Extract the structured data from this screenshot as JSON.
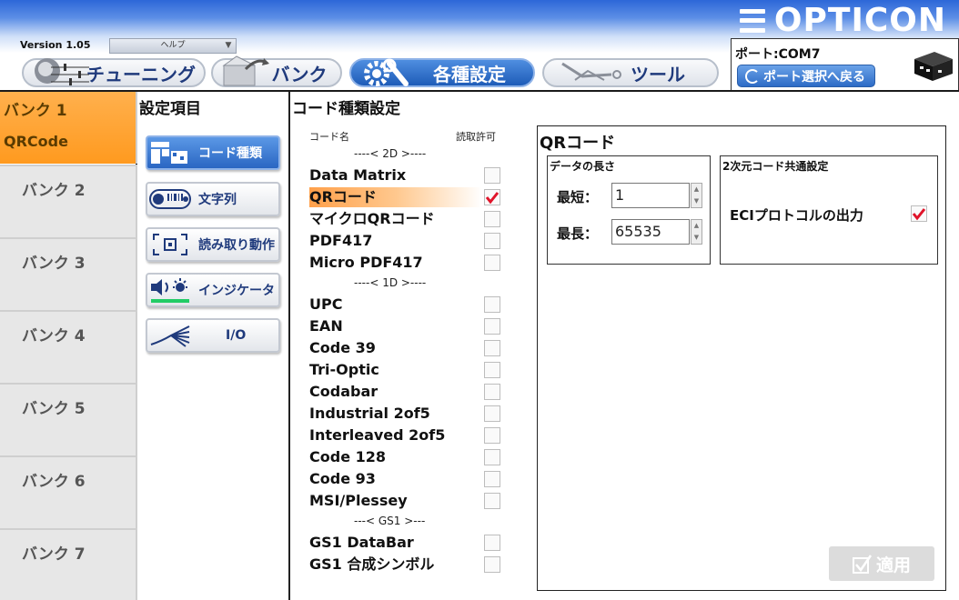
{
  "header": {
    "brand": "OPTICON",
    "version": "Version 1.05",
    "help_menu": "ヘルプ",
    "tabs": [
      {
        "label": "チューニング",
        "icon": "tuning-icon"
      },
      {
        "label": "バンク",
        "icon": "bank-icon"
      },
      {
        "label": "各種設定",
        "icon": "settings-icon"
      },
      {
        "label": "ツール",
        "icon": "tool-icon"
      }
    ],
    "port": {
      "label": "ポート:COM7",
      "back_button": "ポート選択へ戻る"
    }
  },
  "banks": [
    {
      "label": "バンク 1",
      "sub": "QRCode"
    },
    {
      "label": "バンク 2"
    },
    {
      "label": "バンク 3"
    },
    {
      "label": "バンク 4"
    },
    {
      "label": "バンク 5"
    },
    {
      "label": "バンク 6"
    },
    {
      "label": "バンク 7"
    }
  ],
  "settings": {
    "title": "設定項目",
    "items": [
      {
        "label": "コード種類",
        "icon": "qr-barcode-icon"
      },
      {
        "label": "文字列",
        "icon": "data-string-icon"
      },
      {
        "label": "読み取り動作",
        "icon": "scan-frame-icon"
      },
      {
        "label": "インジケータ",
        "icon": "indicator-icon"
      },
      {
        "label": "I/O",
        "icon": "cable-icon"
      }
    ]
  },
  "codelist": {
    "title": "コード種類設定",
    "col_name": "コード名",
    "col_allow": "読取許可",
    "sep_2d": "----< 2D >----",
    "sep_1d": "----< 1D >----",
    "sep_gs1": "---< GS1 >---",
    "codes_2d": [
      {
        "name": "Data Matrix",
        "checked": false
      },
      {
        "name": "QRコード",
        "checked": true,
        "selected": true
      },
      {
        "name": "マイクロQRコード",
        "checked": false
      },
      {
        "name": "PDF417",
        "checked": false
      },
      {
        "name": "Micro PDF417",
        "checked": false
      }
    ],
    "codes_1d": [
      {
        "name": "UPC",
        "checked": false
      },
      {
        "name": "EAN",
        "checked": false
      },
      {
        "name": "Code 39",
        "checked": false
      },
      {
        "name": "Tri-Optic",
        "checked": false
      },
      {
        "name": "Codabar",
        "checked": false
      },
      {
        "name": "Industrial 2of5",
        "checked": false
      },
      {
        "name": "Interleaved 2of5",
        "checked": false
      },
      {
        "name": "Code 128",
        "checked": false
      },
      {
        "name": "Code 93",
        "checked": false
      },
      {
        "name": "MSI/Plessey",
        "checked": false
      }
    ],
    "codes_gs1": [
      {
        "name": "GS1 DataBar",
        "checked": false
      },
      {
        "name": "GS1 合成シンボル",
        "checked": false
      }
    ]
  },
  "detail": {
    "title": "QRコード",
    "length_group": {
      "title": "データの長さ",
      "min_label": "最短：",
      "min_value": "1",
      "max_label": "最長：",
      "max_value": "65535"
    },
    "common_group": {
      "title": "2次元コード共通設定",
      "eci_label": "ECIプロトコルの出力",
      "eci_checked": true
    },
    "apply_button": "適用"
  },
  "colors": {
    "accent_blue": "#2a66c2",
    "bank_active": "#ff9a1f",
    "check_red": "#e0142a"
  }
}
